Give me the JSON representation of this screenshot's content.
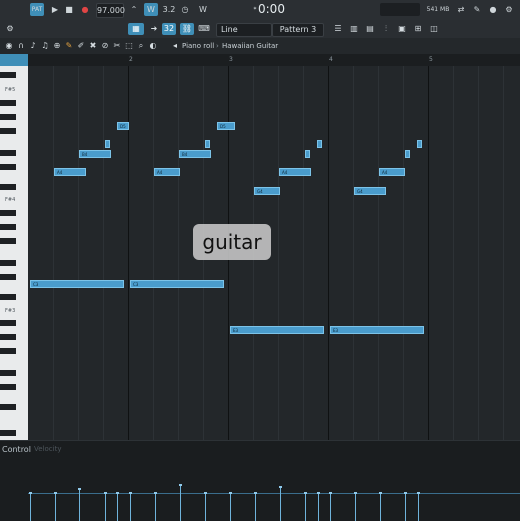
{
  "transport": {
    "badge": "PAT",
    "tempo": "97.000",
    "time": "0:00",
    "time_small": ":00",
    "mode": "Line",
    "pattern": "Pattern 3",
    "memory": "541 MB",
    "memory_sub": "0",
    "step": "3.2"
  },
  "piano_roll": {
    "title": "Piano roll",
    "separator": "›",
    "instrument": "Hawaiian Guitar",
    "bar_numbers": [
      "2",
      "3",
      "4",
      "5"
    ],
    "key_labels": [
      "F#5",
      "F#4",
      "F#3"
    ],
    "notes": [
      {
        "label": "D5",
        "row": 59
      },
      {
        "label": "B4",
        "row": 56
      },
      {
        "label": "A4",
        "row": 54
      },
      {
        "label": "G4",
        "row": 52
      },
      {
        "label": "E3",
        "row": 36
      },
      {
        "label": "C3",
        "row": 32
      }
    ]
  },
  "control": {
    "label": "Control",
    "sub": "Velocity"
  },
  "caption": "guitar"
}
